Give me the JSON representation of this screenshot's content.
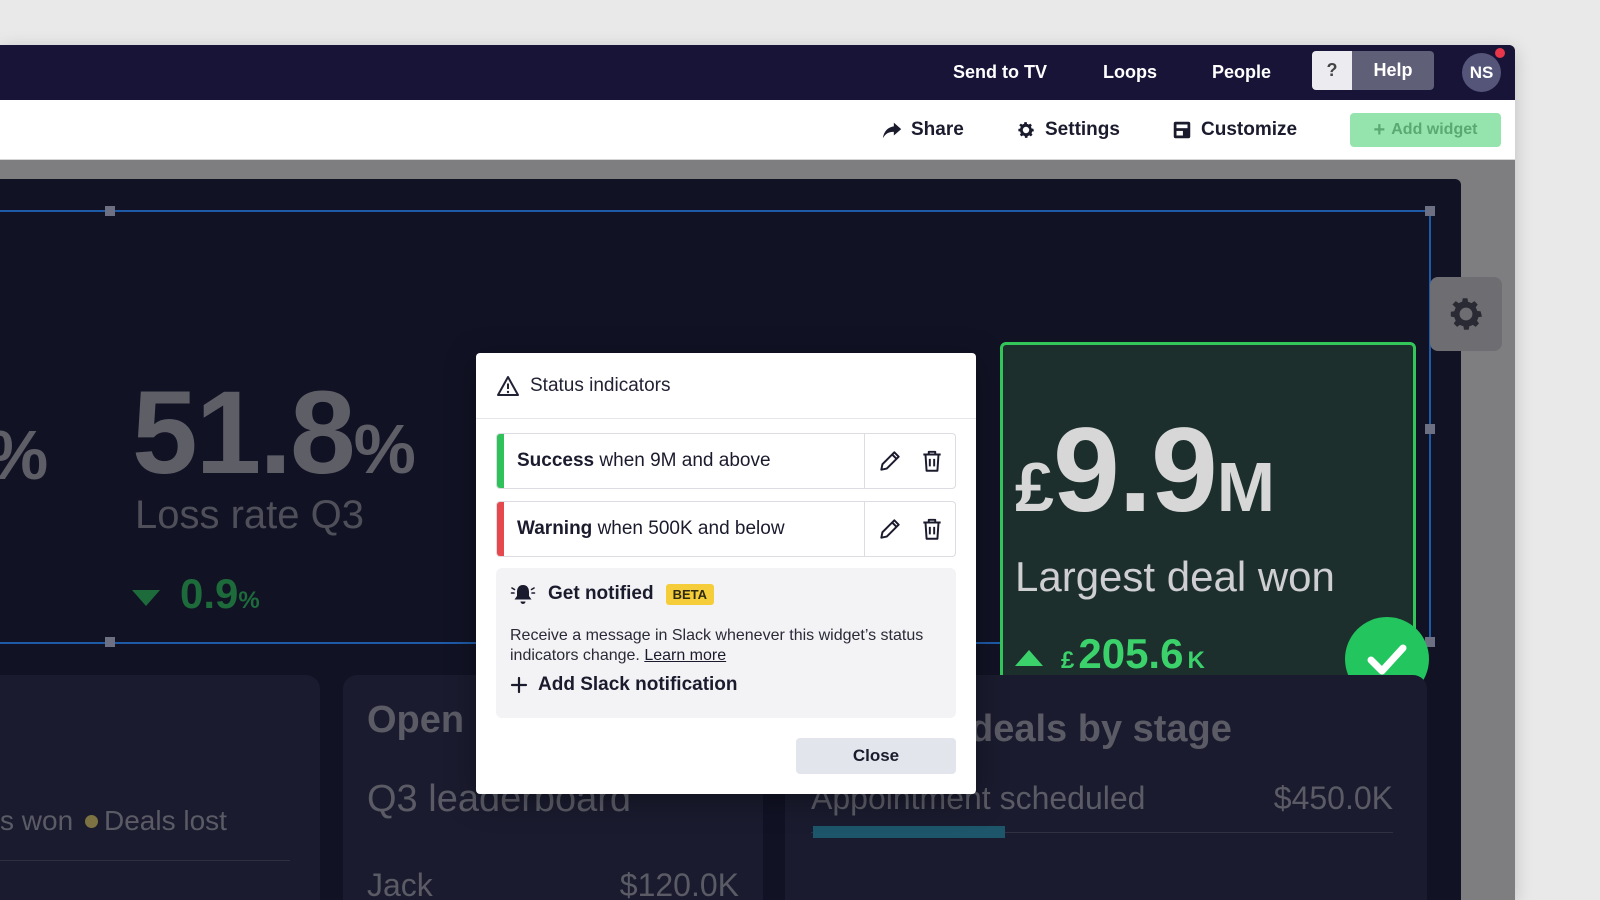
{
  "topbar": {
    "nav": [
      "Send to TV",
      "Loops",
      "People"
    ],
    "help_q": "?",
    "help_label": "Help",
    "avatar_initials": "NS"
  },
  "toolbar": {
    "share": "Share",
    "settings": "Settings",
    "customize": "Customize",
    "add_widget": "Add widget"
  },
  "kpis": {
    "left_partial_unit": "%",
    "loss_rate": {
      "value": "51.8",
      "unit": "%",
      "label": "Loss rate Q3",
      "delta": "0.9",
      "delta_unit": "%"
    },
    "largest_deal": {
      "currency": "£",
      "value": "9.9",
      "unit": "M",
      "label": "Largest deal won",
      "delta_currency": "£",
      "delta": "205.6",
      "delta_unit": "K"
    }
  },
  "panels": {
    "left": {
      "legend_won": "s won",
      "legend_lost": "Deals lost"
    },
    "middle": {
      "title_partial": "Open",
      "subtitle": "Q3 leaderboard",
      "rows": [
        {
          "name": "Jack",
          "value": "$120.0K"
        }
      ]
    },
    "right": {
      "title_partial": "deals by stage",
      "rows": [
        {
          "stage": "Appointment scheduled",
          "value": "$450.0K",
          "progress": 0.33
        }
      ]
    }
  },
  "modal": {
    "title": "Status indicators",
    "indicators": [
      {
        "status": "Success",
        "condition": "when 9M and above",
        "color": "#2fc25a"
      },
      {
        "status": "Warning",
        "condition": "when 500K and below",
        "color": "#e5484d"
      }
    ],
    "notify": {
      "title": "Get notified",
      "badge": "BETA",
      "description": "Receive a message in Slack whenever this widget’s status indicators change.",
      "learn_more": "Learn more",
      "add_label": "Add Slack notification"
    },
    "close": "Close"
  },
  "colors": {
    "topbar": "#181437",
    "success": "#22c55e",
    "add_widget_bg": "#96e4ad",
    "dash_bg": "#111224"
  }
}
